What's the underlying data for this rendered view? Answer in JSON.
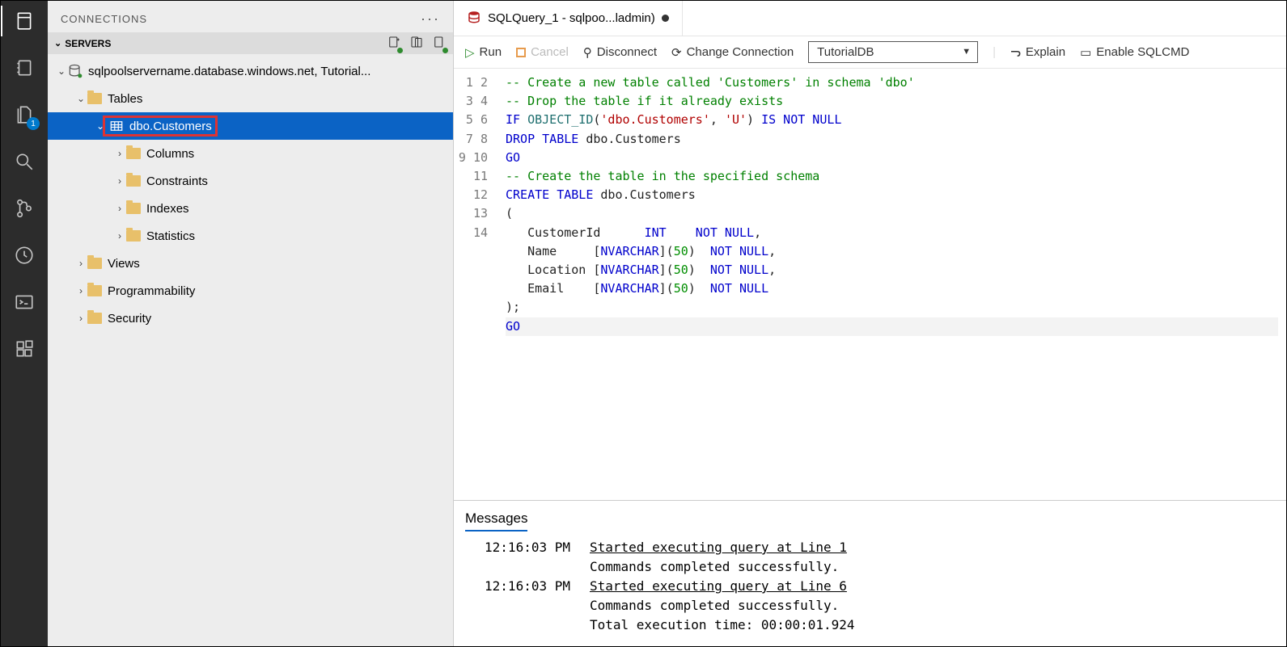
{
  "panelTitle": "CONNECTIONS",
  "serversLabel": "SERVERS",
  "explorerBadge": "1",
  "tree": {
    "server": "sqlpoolservername.database.windows.net, Tutorial...",
    "tables": "Tables",
    "dboCustomers": "dbo.Customers",
    "columns": "Columns",
    "constraints": "Constraints",
    "indexes": "Indexes",
    "statistics": "Statistics",
    "views": "Views",
    "programmability": "Programmability",
    "security": "Security"
  },
  "tab": {
    "title": "SQLQuery_1 - sqlpoo...ladmin)"
  },
  "toolbar": {
    "run": "Run",
    "cancel": "Cancel",
    "disconnect": "Disconnect",
    "changeConn": "Change Connection",
    "dbSelected": "TutorialDB",
    "explain": "Explain",
    "sqlcmd": "Enable SQLCMD"
  },
  "code": {
    "l1": "-- Create a new table called 'Customers' in schema 'dbo'",
    "l2": "-- Drop the table if it already exists",
    "l3a": "IF",
    "l3b": "OBJECT_ID",
    "l3c": "'dbo.Customers'",
    "l3d": "'U'",
    "l3e": "IS NOT NULL",
    "l4a": "DROP TABLE",
    "l4b": " dbo.Customers",
    "l5": "GO",
    "l6": "-- Create the table in the specified schema",
    "l7a": "CREATE TABLE",
    "l7b": " dbo.Customers",
    "l8": "(",
    "l9a": "   CustomerId      ",
    "l9b": "INT",
    "l9c": "    NOT NULL",
    "l9d": ",",
    "l10a": "   Name     [",
    "l10b": "NVARCHAR",
    "l10c": "](",
    "l10n": "50",
    "l10d": ")  ",
    "l10e": "NOT NULL",
    "l10f": ",",
    "l11a": "   Location [",
    "l11b": "NVARCHAR",
    "l11c": "](",
    "l11n": "50",
    "l11d": ")  ",
    "l11e": "NOT NULL",
    "l11f": ",",
    "l12a": "   Email    [",
    "l12b": "NVARCHAR",
    "l12c": "](",
    "l12n": "50",
    "l12d": ")  ",
    "l12e": "NOT NULL",
    "l13": ");",
    "l14": "GO"
  },
  "lineNumbers": [
    "1",
    "2",
    "3",
    "4",
    "5",
    "6",
    "7",
    "8",
    "9",
    "10",
    "11",
    "12",
    "13",
    "14"
  ],
  "messages": {
    "title": "Messages",
    "t1": "12:16:03 PM",
    "m1a": "Started executing query at Line 1",
    "m1b": "Commands completed successfully.",
    "t2": "12:16:03 PM",
    "m2a": "Started executing query at Line 6",
    "m2b": "Commands completed successfully.",
    "m2c": "Total execution time: 00:00:01.924"
  }
}
